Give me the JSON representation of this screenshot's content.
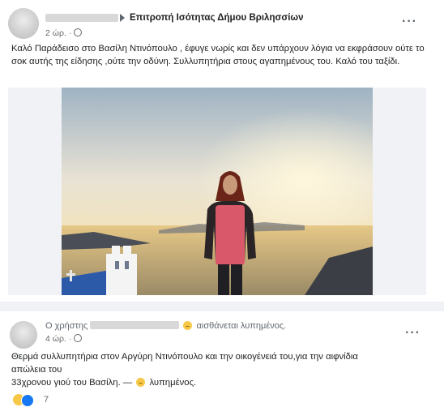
{
  "post1": {
    "group_name": "Επιτροπή Ισότητας Δήμου Βριλησσίων",
    "time": "2 ώρ. ·",
    "body": "Καλό Παράδεισο στο Βασίλη Ντινόπουλο , έφυγε νωρίς και δεν  υπάρχουν λόγια να εκφράσουν ούτε το σοκ αυτής της είδησης ,ούτε την οδύνη. Συλλυπητήρια στους αγαπημένους του. Καλό του ταξίδι."
  },
  "post2": {
    "user_prefix": "Ο χρήστης",
    "feeling_text": "αισθάνεται λυπημένος.",
    "time": "4 ώρ. ·",
    "body_line1": "Θερμά συλλυπητήρια στον Αργύρη Ντινόπουλο και την οικογένειά του,για την αιφνίδια",
    "body_line2": "απώλεια του",
    "body_line3": "33χρονου γιού του Βασίλη. —",
    "body_feeling": "λυπημένος.",
    "reaction_count": "7"
  },
  "icons": {
    "more": "more-options-icon",
    "privacy": "globe-icon",
    "arrow": "right-arrow-icon",
    "feeling": "sad-face-icon",
    "reactions": [
      "sad-reaction-icon",
      "like-reaction-icon"
    ]
  },
  "colors": {
    "text": "#1c1e21",
    "meta": "#65676b",
    "divider": "#f0f2f5",
    "like_blue": "#1877f2"
  }
}
